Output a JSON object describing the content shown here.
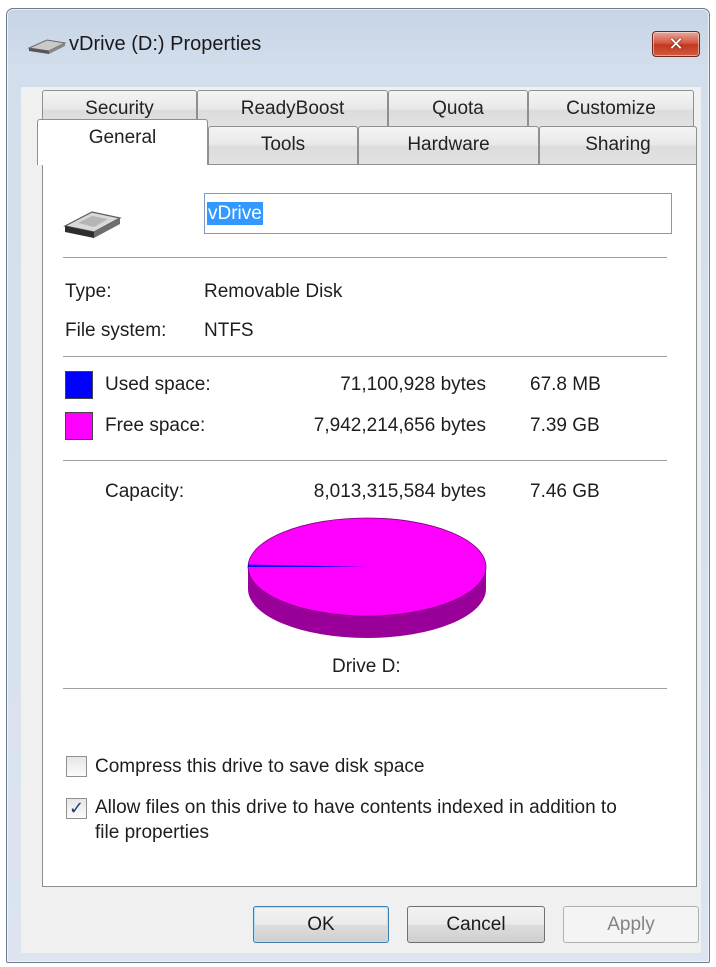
{
  "window": {
    "title": "vDrive (D:) Properties",
    "close_glyph": "✕"
  },
  "tabs": {
    "row1": [
      "Security",
      "ReadyBoost",
      "Quota",
      "Customize"
    ],
    "row2": [
      "General",
      "Tools",
      "Hardware",
      "Sharing"
    ],
    "active": "General"
  },
  "general": {
    "drive_name": "vDrive",
    "type_label": "Type:",
    "type_value": "Removable Disk",
    "fs_label": "File system:",
    "fs_value": "NTFS",
    "used": {
      "label": "Used space:",
      "bytes": "71,100,928 bytes",
      "size": "67.8 MB",
      "color": "#0000ff"
    },
    "free": {
      "label": "Free space:",
      "bytes": "7,942,214,656 bytes",
      "size": "7.39 GB",
      "color": "#ff00ff"
    },
    "capacity": {
      "label": "Capacity:",
      "bytes": "8,013,315,584 bytes",
      "size": "7.46 GB"
    },
    "used_fraction": 0.00887,
    "drive_label": "Drive D:",
    "compress": {
      "label": "Compress this drive to save disk space",
      "checked": false
    },
    "index": {
      "label_line1": "Allow files on this drive to have contents indexed in addition to",
      "label_line2": "file properties",
      "checked": true
    }
  },
  "buttons": {
    "ok": "OK",
    "cancel": "Cancel",
    "apply": "Apply"
  }
}
